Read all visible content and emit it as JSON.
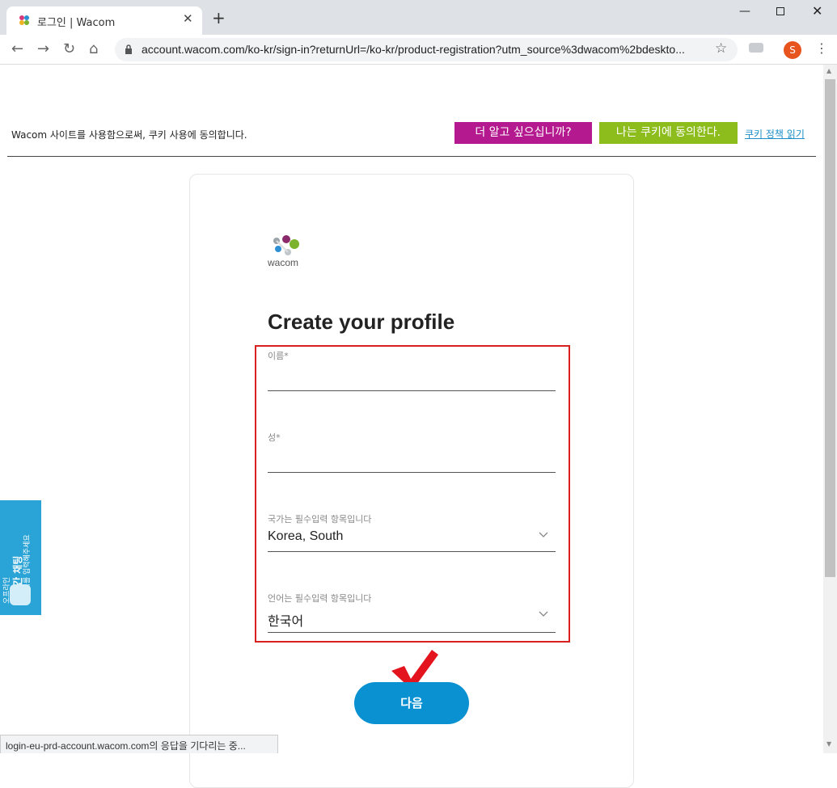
{
  "browser": {
    "tab_title": "로그인 | Wacom",
    "tab_close": "✕",
    "new_tab": "+",
    "url": "account.wacom.com/ko-kr/sign-in?returnUrl=/ko-kr/product-registration?utm_source%3dwacom%2bdeskto...",
    "profile_initial": "S",
    "window_min": "—",
    "window_close": "✕",
    "back_icon": "←",
    "forward_icon": "→",
    "reload_icon": "↻",
    "home_icon": "⌂",
    "star_icon": "☆",
    "menu_icon": "⋮",
    "status_text": "login-eu-prd-account.wacom.com의 응답을 기다리는 중..."
  },
  "cookie_banner": {
    "text": "Wacom 사이트를 사용함으로써, 쿠키 사용에 동의합니다.",
    "learn_more": "더 알고 싶으십니까?",
    "agree": "나는 쿠키에 동의한다.",
    "policy_link": "쿠키 정책 읽기"
  },
  "logo": {
    "text": "wacom"
  },
  "form": {
    "title": "Create your profile",
    "first_name_label": "이름*",
    "last_name_label": "성*",
    "country_label": "국가는 필수입력 항목입니다",
    "country_value": "Korea, South",
    "language_label": "언어는 필수입력 항목입니다",
    "language_value": "한국어",
    "next_button": "다음"
  },
  "chat_widget": {
    "line1": "오프라인",
    "line2": "실시간 채팅",
    "line3": "메시지를 입력해주세요"
  },
  "colors": {
    "learn_more_bg": "#b5198f",
    "agree_bg": "#8dbd1c",
    "next_button_bg": "#0a91d2",
    "highlight_border": "#d9201e",
    "chat_widget_bg": "#2aa3d6"
  }
}
